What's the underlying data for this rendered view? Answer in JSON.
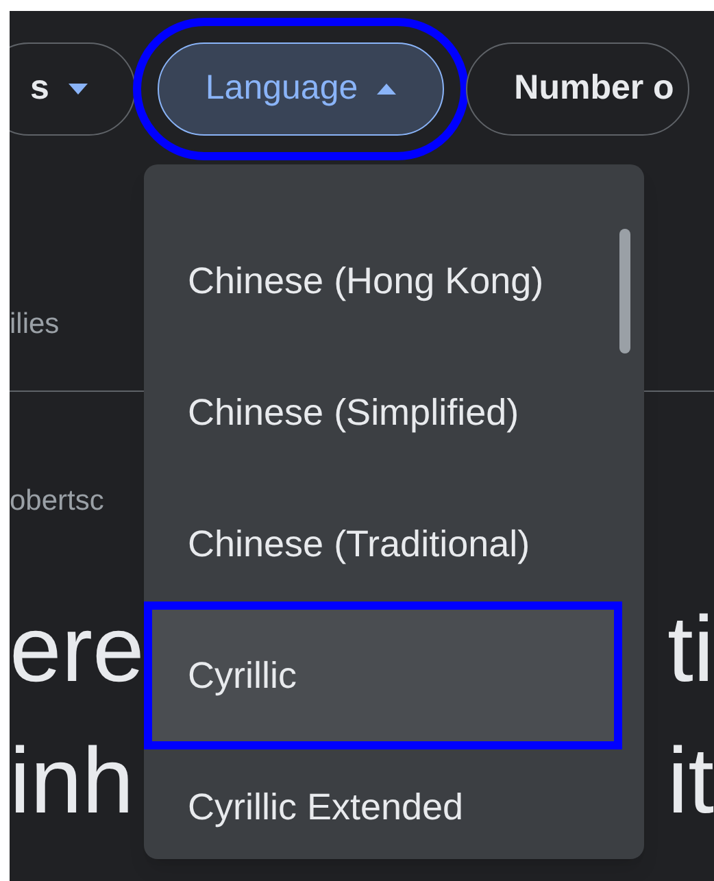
{
  "filter_chips": [
    {
      "label": "s",
      "open": false,
      "selected": false,
      "highlighted": false
    },
    {
      "label": "Language",
      "open": true,
      "selected": true,
      "highlighted": true
    },
    {
      "label": "Number o",
      "selected": false,
      "highlighted": false
    }
  ],
  "background": {
    "category_text": "ilies",
    "author_text": "obertsc",
    "heading_left": [
      "ere",
      "inh"
    ],
    "heading_right": [
      "ti",
      "it"
    ]
  },
  "language_menu": {
    "items": [
      {
        "label": "Chinese (Hong Kong)",
        "selected": false,
        "highlighted": false
      },
      {
        "label": "Chinese (Simplified)",
        "selected": false,
        "highlighted": false
      },
      {
        "label": "Chinese (Traditional)",
        "selected": false,
        "highlighted": false
      },
      {
        "label": "Cyrillic",
        "selected": true,
        "highlighted": true
      },
      {
        "label": "Cyrillic Extended",
        "selected": false,
        "highlighted": false
      }
    ]
  }
}
